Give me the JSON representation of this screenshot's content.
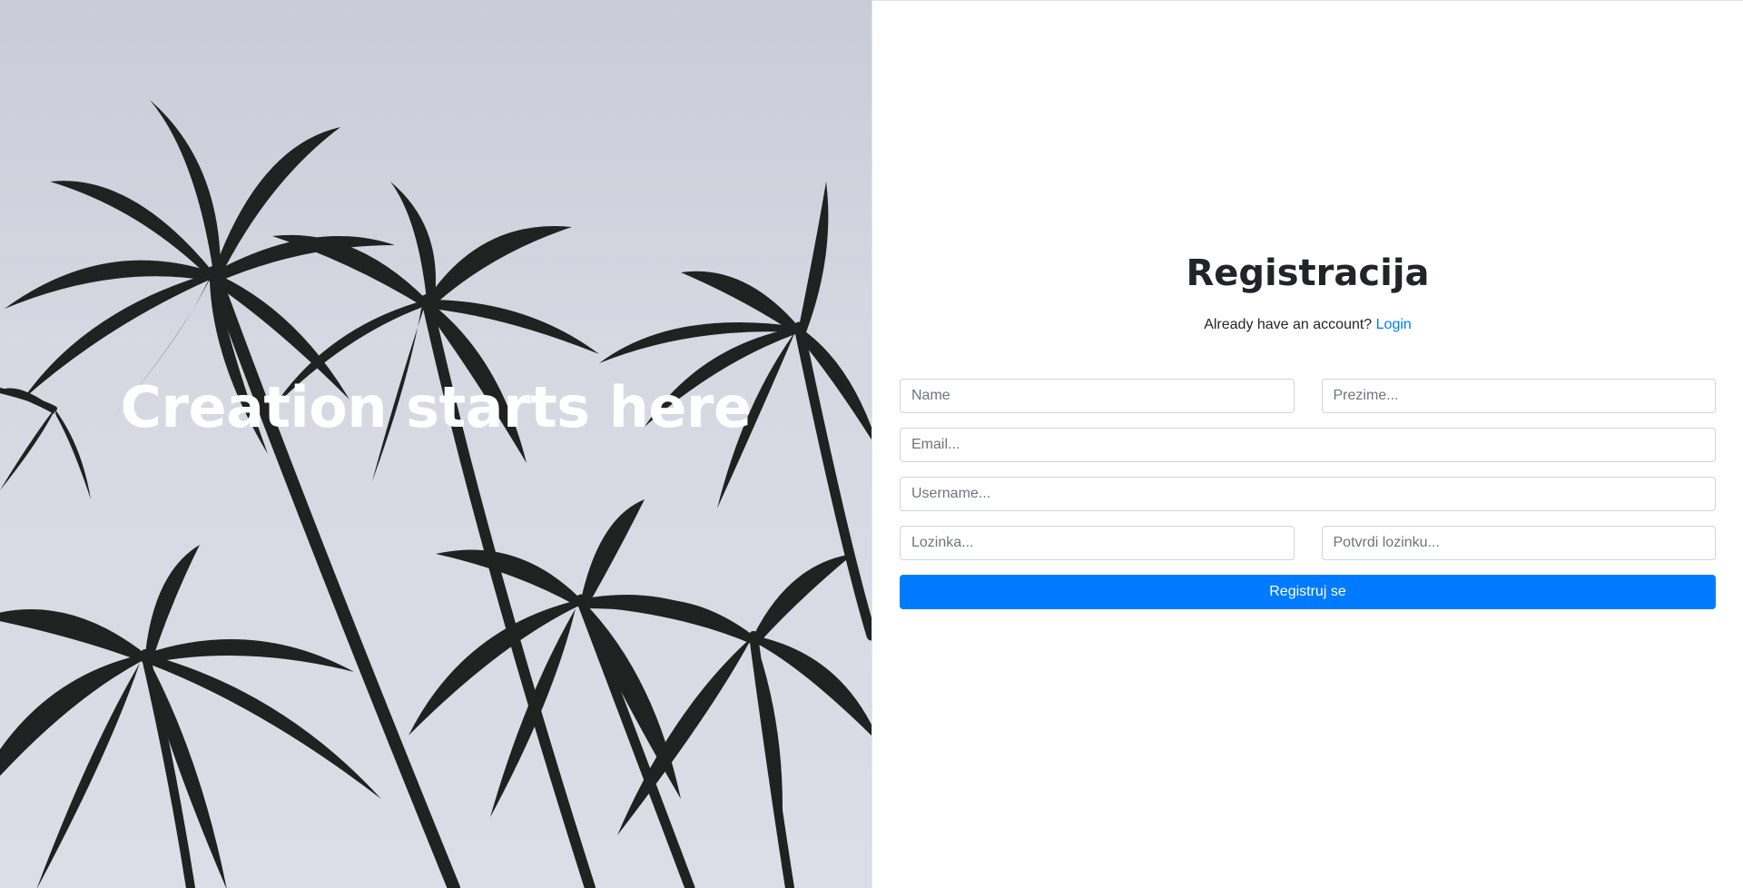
{
  "hero": {
    "title": "Creation starts here",
    "background_image": "palm-trees-silhouette"
  },
  "form": {
    "title": "Registracija",
    "login_prompt": "Already have an account?",
    "login_link": "Login",
    "fields": {
      "name_placeholder": "Name",
      "surname_placeholder": "Prezime...",
      "email_placeholder": "Email...",
      "username_placeholder": "Username...",
      "password_placeholder": "Lozinka...",
      "confirm_password_placeholder": "Potvrdi lozinku..."
    },
    "submit_label": "Registruj se"
  },
  "colors": {
    "accent": "#007bff",
    "text": "#212529",
    "sky": "#d6d8e2",
    "palm": "#1e2220"
  }
}
